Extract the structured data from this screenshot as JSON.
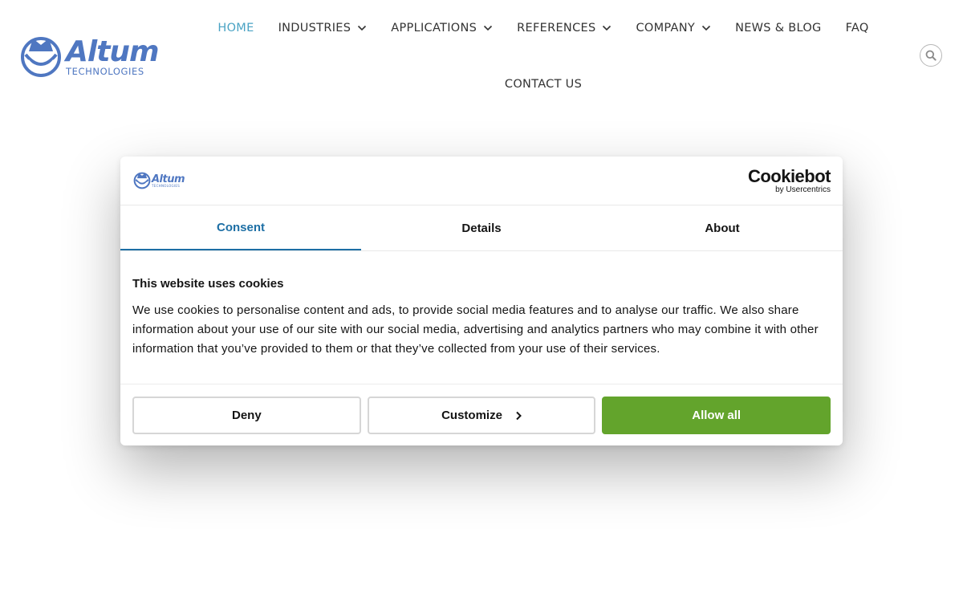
{
  "site": {
    "logo": {
      "word": "Altum",
      "sub": "TECHNOLOGIES"
    },
    "nav": {
      "row1": [
        {
          "label": "HOME",
          "dropdown": false,
          "active": true
        },
        {
          "label": "INDUSTRIES",
          "dropdown": true,
          "active": false
        },
        {
          "label": "APPLICATIONS",
          "dropdown": true,
          "active": false
        },
        {
          "label": "REFERENCES",
          "dropdown": true,
          "active": false
        },
        {
          "label": "COMPANY",
          "dropdown": true,
          "active": false
        },
        {
          "label": "NEWS & BLOG",
          "dropdown": false,
          "active": false
        },
        {
          "label": "FAQ",
          "dropdown": false,
          "active": false
        }
      ],
      "row2": [
        {
          "label": "CONTACT US",
          "dropdown": false,
          "active": false
        }
      ]
    },
    "search_icon": "search-icon"
  },
  "cookie_dialog": {
    "logo": {
      "word": "Altum",
      "sub": "TECHNOLOGIES"
    },
    "brand": {
      "word": "Cookiebot",
      "sub": "by Usercentrics"
    },
    "tabs": [
      {
        "label": "Consent",
        "active": true
      },
      {
        "label": "Details",
        "active": false
      },
      {
        "label": "About",
        "active": false
      }
    ],
    "title": "This website uses cookies",
    "text": "We use cookies to personalise content and ads, to provide social media features and to analyse our traffic. We also share information about your use of our site with our social media, advertising and analytics partners who may combine it with other information that you’ve provided to them or that they’ve collected from your use of their services.",
    "buttons": {
      "deny": "Deny",
      "customize": "Customize",
      "allow_all": "Allow all"
    }
  },
  "colors": {
    "brand_blue": "#4f77c1",
    "nav_active": "#4aa3c4",
    "tab_active": "#1d6fa5",
    "allow_green": "#63a42c"
  }
}
